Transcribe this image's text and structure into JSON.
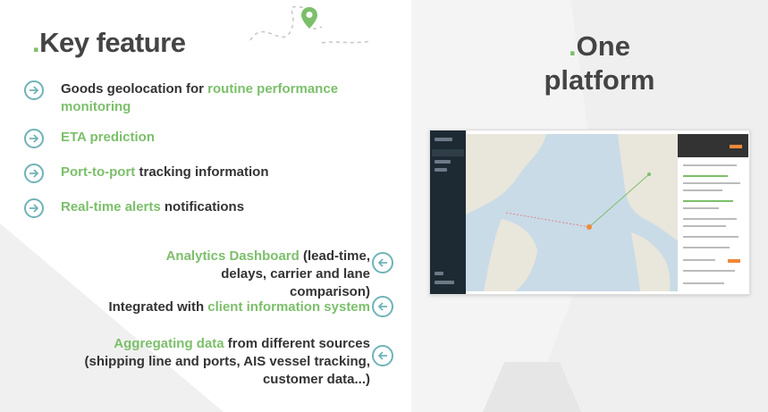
{
  "left": {
    "title_dot": ".",
    "title": "Key feature",
    "features": [
      {
        "pre": "Goods geolocation for ",
        "hl": "routine performance monitoring",
        "post": ""
      },
      {
        "pre": "",
        "hl": "ETA prediction",
        "post": ""
      },
      {
        "pre": "",
        "hl": "Port-to-port",
        "post": " tracking information"
      },
      {
        "pre": "",
        "hl": "Real-time alerts",
        "post": " notifications"
      }
    ]
  },
  "right_features": [
    {
      "hl": "Analytics Dashboard",
      "line1_post": " (lead-time,",
      "line2": "delays, carrier and lane",
      "line3": "comparison)"
    },
    {
      "pre": "Integrated with ",
      "hl": "client information system"
    },
    {
      "hl": "Aggregating data",
      "line1_post": " from different sources",
      "line2": "(shipping line and ports, AIS vessel tracking,",
      "line3": "customer data...)"
    }
  ],
  "right": {
    "title_dot": ".",
    "title_line1": "One",
    "title_line2": "platform"
  },
  "colors": {
    "accent_green": "#7cbf6b",
    "arrow_teal": "#6fb3b8",
    "text_dark": "#333333"
  },
  "icons": [
    "arrow-right-circle-icon",
    "arrow-left-circle-icon",
    "map-pin-icon"
  ]
}
